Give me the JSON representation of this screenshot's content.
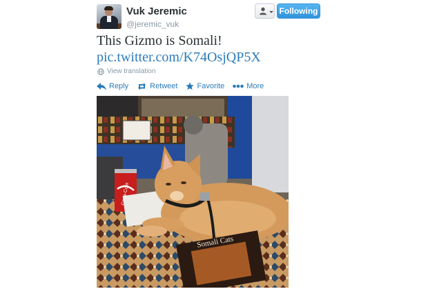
{
  "tweet": {
    "author_name": "Vuk Jeremic",
    "author_handle": "@jeremic_vuk",
    "follow_label": "Following",
    "text": "This Gizmo is Somali!",
    "link": "pic.twitter.com/K74OsjQP5X",
    "translate_label": "View translation"
  },
  "actions": [
    {
      "label": "Reply",
      "icon": "reply-icon"
    },
    {
      "label": "Retweet",
      "icon": "retweet-icon"
    },
    {
      "label": "Favorite",
      "icon": "star-icon"
    },
    {
      "label": "More",
      "icon": "more-icon"
    }
  ],
  "photo": {
    "can_label": "Coca-Cola",
    "book_title": "Somali Cats"
  },
  "colors": {
    "link": "#2b7bb9",
    "follow_button": "#3b94d9",
    "muted": "#8899a6"
  }
}
